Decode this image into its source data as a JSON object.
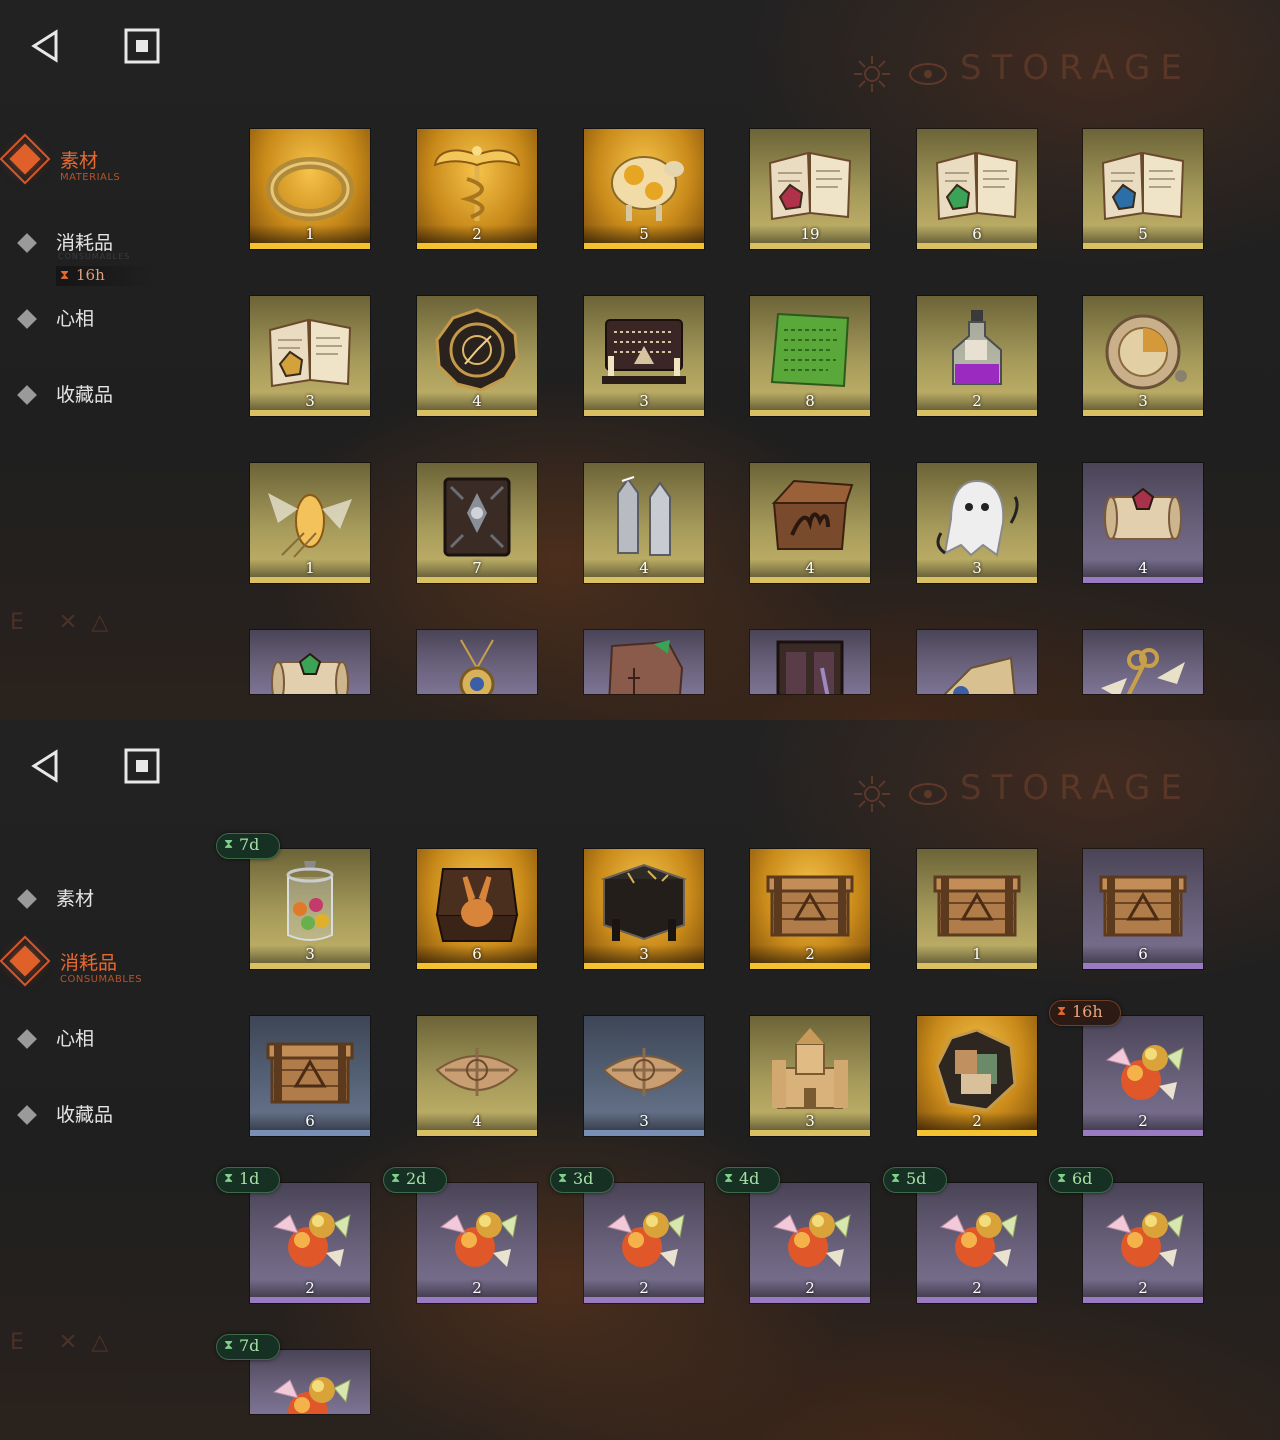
{
  "panels": [
    {
      "storage_title": "STORAGE",
      "nav": [
        {
          "label": "素材",
          "sub": "MATERIALS",
          "active": true
        },
        {
          "label": "消耗品",
          "sub": "CONSUMABLES",
          "active": false
        },
        {
          "label": "心相",
          "sub": "",
          "active": false
        },
        {
          "label": "收藏品",
          "sub": "",
          "active": false
        }
      ],
      "nav_timer": "16h",
      "items": [
        {
          "icon": "ring-icon",
          "count": "1",
          "rarity": "gold"
        },
        {
          "icon": "caduceus-icon",
          "count": "2",
          "rarity": "gold"
        },
        {
          "icon": "golden-sheep-icon",
          "count": "5",
          "rarity": "gold"
        },
        {
          "icon": "red-gem-book-icon",
          "count": "19",
          "rarity": "yellow"
        },
        {
          "icon": "green-gem-book-icon",
          "count": "6",
          "rarity": "yellow"
        },
        {
          "icon": "blue-gem-book-icon",
          "count": "5",
          "rarity": "yellow"
        },
        {
          "icon": "gold-gem-book-icon",
          "count": "3",
          "rarity": "yellow"
        },
        {
          "icon": "clockwork-astrolabe-icon",
          "count": "4",
          "rarity": "yellow"
        },
        {
          "icon": "ouija-board-icon",
          "count": "3",
          "rarity": "yellow"
        },
        {
          "icon": "green-tablet-icon",
          "count": "8",
          "rarity": "yellow"
        },
        {
          "icon": "potion-bottle-icon",
          "count": "2",
          "rarity": "yellow"
        },
        {
          "icon": "pocket-watch-icon",
          "count": "3",
          "rarity": "yellow"
        },
        {
          "icon": "firefly-icon",
          "count": "1",
          "rarity": "yellow"
        },
        {
          "icon": "leather-tome-icon",
          "count": "7",
          "rarity": "yellow"
        },
        {
          "icon": "silver-bullets-icon",
          "count": "4",
          "rarity": "yellow"
        },
        {
          "icon": "hand-box-icon",
          "count": "4",
          "rarity": "yellow"
        },
        {
          "icon": "ghost-icon",
          "count": "3",
          "rarity": "yellow"
        },
        {
          "icon": "red-scroll-icon",
          "count": "4",
          "rarity": "purple"
        },
        {
          "icon": "green-scroll-icon",
          "count": "",
          "rarity": "purple"
        },
        {
          "icon": "amulet-icon",
          "count": "",
          "rarity": "purple"
        },
        {
          "icon": "stone-carving-icon",
          "count": "",
          "rarity": "purple"
        },
        {
          "icon": "window-frame-icon",
          "count": "",
          "rarity": "purple"
        },
        {
          "icon": "fragment-icon",
          "count": "",
          "rarity": "purple"
        },
        {
          "icon": "winged-key-icon",
          "count": "",
          "rarity": "purple"
        }
      ]
    },
    {
      "storage_title": "STORAGE",
      "nav": [
        {
          "label": "素材",
          "sub": "",
          "active": false
        },
        {
          "label": "消耗品",
          "sub": "CONSUMABLES",
          "active": true
        },
        {
          "label": "心相",
          "sub": "",
          "active": false
        },
        {
          "label": "收藏品",
          "sub": "",
          "active": false
        }
      ],
      "items": [
        {
          "icon": "candy-jar-icon",
          "count": "3",
          "rarity": "yellow",
          "timer": "7d"
        },
        {
          "icon": "rabbit-box-icon",
          "count": "6",
          "rarity": "gold"
        },
        {
          "icon": "rune-table-icon",
          "count": "3",
          "rarity": "gold"
        },
        {
          "icon": "wooden-crate-icon",
          "count": "2",
          "rarity": "gold"
        },
        {
          "icon": "wooden-crate-icon",
          "count": "1",
          "rarity": "yellow"
        },
        {
          "icon": "wooden-crate-icon",
          "count": "6",
          "rarity": "purple"
        },
        {
          "icon": "wooden-crate-icon",
          "count": "6",
          "rarity": "blue"
        },
        {
          "icon": "parcel-icon",
          "count": "4",
          "rarity": "yellow"
        },
        {
          "icon": "parcel-icon",
          "count": "3",
          "rarity": "blue"
        },
        {
          "icon": "sand-castle-icon",
          "count": "3",
          "rarity": "yellow"
        },
        {
          "icon": "hexagon-puzzle-icon",
          "count": "2",
          "rarity": "gold"
        },
        {
          "icon": "candy-icon",
          "count": "2",
          "rarity": "purple",
          "timer": "16h",
          "timer_style": "orange"
        },
        {
          "icon": "candy-icon",
          "count": "2",
          "rarity": "purple",
          "timer": "1d"
        },
        {
          "icon": "candy-icon",
          "count": "2",
          "rarity": "purple",
          "timer": "2d"
        },
        {
          "icon": "candy-icon",
          "count": "2",
          "rarity": "purple",
          "timer": "3d"
        },
        {
          "icon": "candy-icon",
          "count": "2",
          "rarity": "purple",
          "timer": "4d"
        },
        {
          "icon": "candy-icon",
          "count": "2",
          "rarity": "purple",
          "timer": "5d"
        },
        {
          "icon": "candy-icon",
          "count": "2",
          "rarity": "purple",
          "timer": "6d"
        },
        {
          "icon": "candy-icon",
          "count": "",
          "rarity": "purple",
          "timer": "7d"
        }
      ]
    }
  ]
}
